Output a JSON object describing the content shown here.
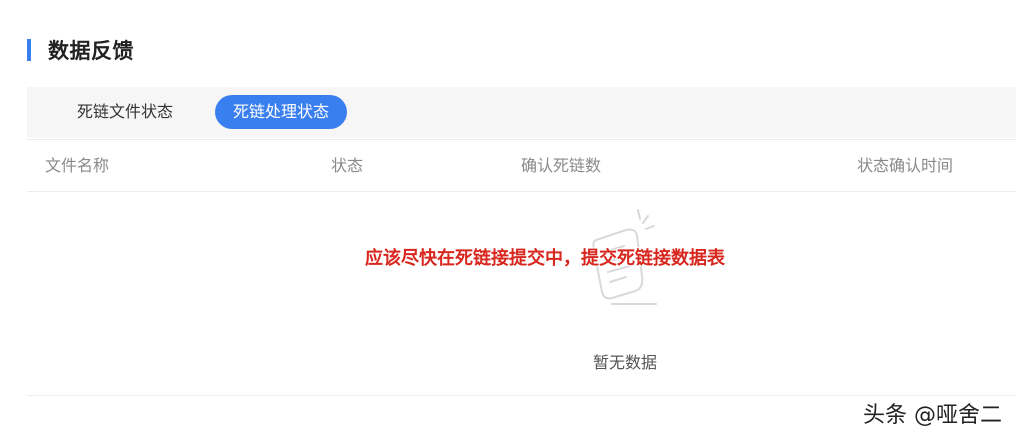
{
  "section": {
    "title": "数据反馈"
  },
  "tabs": [
    {
      "label": "死链文件状态",
      "active": false
    },
    {
      "label": "死链处理状态",
      "active": true
    }
  ],
  "table": {
    "columns": [
      "文件名称",
      "状态",
      "确认死链数",
      "状态确认时间"
    ],
    "rows": [],
    "empty_text": "暂无数据"
  },
  "overlay_caption": "应该尽快在死链接提交中，提交死链接数据表",
  "watermark": "头条 @哑舍二",
  "colors": {
    "accent": "#3a7ff0",
    "caption": "#d8271f",
    "header_text": "#8a8a8a",
    "tabs_background": "#f6f6f6"
  },
  "icons": {
    "empty_state": "empty-document-icon"
  }
}
